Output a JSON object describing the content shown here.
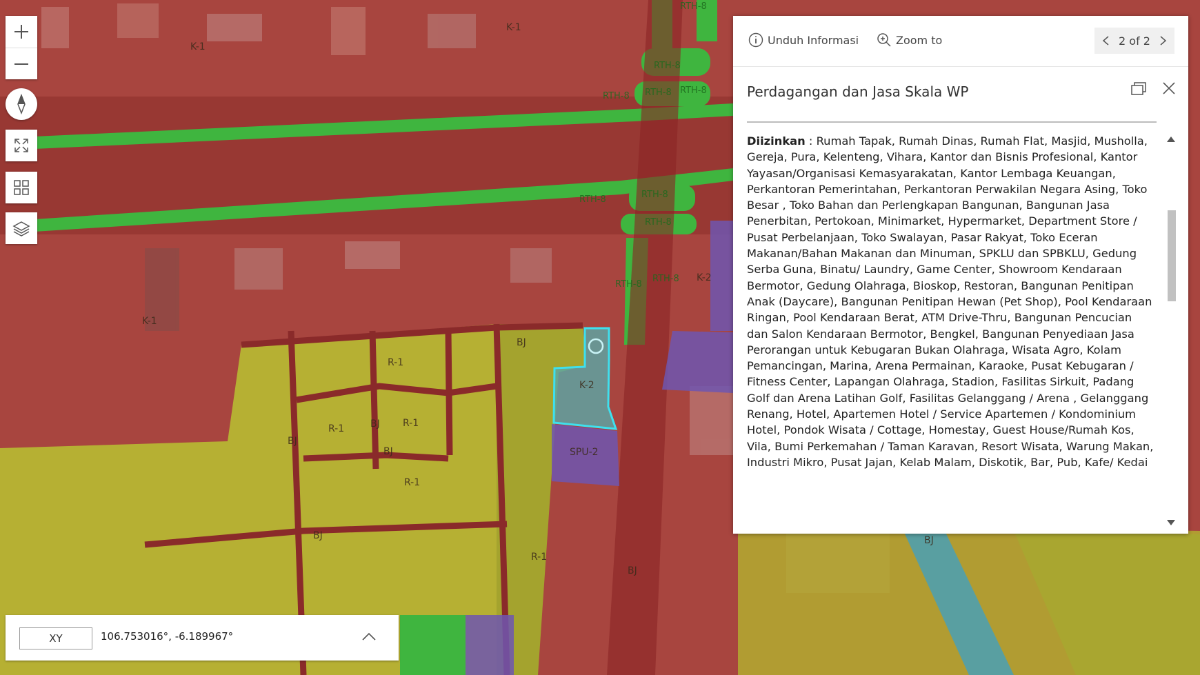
{
  "map": {
    "zone_labels": {
      "k1_top_a": "K-1",
      "k1_top_b": "K-1",
      "k1_mid": "K-1",
      "rth_top": "RTH-8",
      "rth_a": "RTH-8",
      "rth_b": "RTH-8",
      "rth_c": "RTH-8",
      "rth_d": "RTH-8",
      "rth_e": "RTH-8",
      "rth_f": "RTH-8",
      "rth_g": "RTH-8",
      "rth_h": "RTH-8",
      "rth_i": "RTH-8",
      "k2_right": "K-2",
      "k2_selected": "K-2",
      "bj_a": "BJ",
      "bj_b": "BJ",
      "bj_c": "BJ",
      "bj_d": "BJ",
      "bj_e": "BJ",
      "bj_f": "BJ",
      "bj_g": "BJ",
      "r1_a": "R-1",
      "r1_b": "R-1",
      "r1_c": "R-1",
      "r1_d": "R-1",
      "r1_e": "R-1",
      "spu": "SPU-2"
    },
    "colors": {
      "commercial": "#a8413a",
      "green": "#3fb53f",
      "residential": "#b5b131",
      "public": "#7a5aa8",
      "selected_outline": "#3ee0ee",
      "selected_fill": "#5aa7a8"
    }
  },
  "toolbar": {
    "zoom_in_icon": "plus-icon",
    "zoom_out_icon": "minus-icon",
    "compass_icon": "compass-icon",
    "fullscreen_icon": "expand-icon",
    "basemap_icon": "grid-icon",
    "layers_icon": "layers-icon"
  },
  "popup": {
    "download_label": "Unduh Informasi",
    "zoom_label": "Zoom to",
    "pager_text": "2 of 2",
    "title": "Perdagangan dan Jasa Skala WP",
    "content_label": "Diizinkan",
    "content_text": " : Rumah Tapak, Rumah Dinas, Rumah Flat, Masjid, Musholla, Gereja, Pura, Kelenteng, Vihara, Kantor dan Bisnis Profesional, Kantor Yayasan/Organisasi Kemasyarakatan, Kantor Lembaga Keuangan, Perkantoran Pemerintahan, Perkantoran Perwakilan Negara Asing, Toko Besar , Toko Bahan dan Perlengkapan Bangunan, Bangunan Jasa Penerbitan, Pertokoan, Minimarket, Hypermarket, Department Store / Pusat Perbelanjaan, Toko Swalayan, Pasar Rakyat, Toko Eceran Makanan/Bahan Makanan dan Minuman, SPKLU dan SPBKLU, Gedung Serba Guna, Binatu/ Laundry, Game Center, Showroom Kendaraan Bermotor, Gedung Olahraga, Bioskop, Restoran, Bangunan Penitipan Anak (Daycare), Bangunan Penitipan Hewan (Pet Shop), Pool Kendaraan Ringan, Pool Kendaraan Berat, ATM Drive-Thru, Bangunan Pencucian dan Salon Kendaraan Bermotor, Bengkel, Bangunan Penyediaan Jasa Perorangan untuk Kebugaran Bukan Olahraga, Wisata Agro, Kolam Pemancingan, Marina, Arena Permainan, Karaoke, Pusat Kebugaran / Fitness Center, Lapangan Olahraga, Stadion, Fasilitas Sirkuit, Padang Golf dan Arena Latihan Golf, Fasilitas Gelanggang / Arena , Gelanggang Renang, Hotel, Apartemen Hotel / Service Apartemen / Kondominium Hotel, Pondok Wisata / Cottage, Homestay, Guest House/Rumah Kos, Vila, Bumi Perkemahan / Taman Karavan, Resort Wisata, Warung Makan, Industri Mikro, Pusat Jajan, Kelab Malam, Diskotik, Bar, Pub, Kafe/ Kedai",
    "scroll_fraction": 0.22
  },
  "coordinates": {
    "format_label": "XY",
    "value": "106.753016°, -6.189967°"
  }
}
